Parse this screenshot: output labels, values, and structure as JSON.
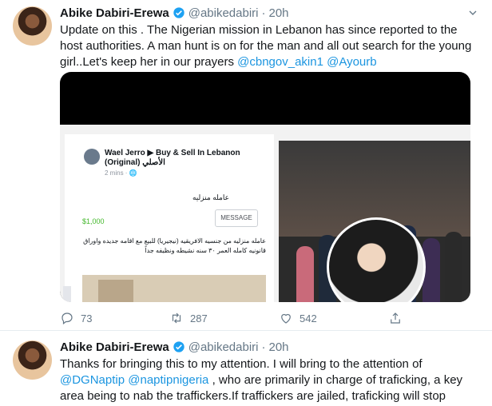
{
  "tweets": [
    {
      "name": "Abike Dabiri-Erewa",
      "handle": "@abikedabiri",
      "separator": "·",
      "time": "20h",
      "text_pre": "Update on this . The Nigerian mission in Lebanon has since reported to the host authorities. A man hunt is on for the man and all out search for the young girl..Let's keep her in our prayers ",
      "mention1": "@cbngov_akin1",
      "mention2": "@Ayourb",
      "media": {
        "fb_title": "Wael Jerro ▶ Buy & Sell In Lebanon (Original) الأصلي",
        "fb_sub": "2 mins · 🌐",
        "fb_arabic": "عامله منزليه",
        "fb_price": "$1,000",
        "fb_message": "MESSAGE",
        "fb_desc": "عامله منزليه من جنسيه الافريقيه (نيجيريا) للبيع مع اقامه جديده واوراق قانونيه كامله العمر ٣٠ سنه نشيطه ونظيفه جداً"
      },
      "counts": {
        "reply": "73",
        "retweet": "287",
        "like": "542"
      }
    },
    {
      "name": "Abike Dabiri-Erewa",
      "handle": "@abikedabiri",
      "separator": "·",
      "time": "20h",
      "text_a": "Thanks for bringing this to my attention. I will bring to the attention of ",
      "mention1": "@DGNaptip",
      "mention2": "@naptipnigeria",
      "text_b": " , who are primarily in charge of traficking, a key area being to nab the traffickers.If traffickers are jailed, traficking will stop"
    }
  ],
  "colors": {
    "link": "#1b95e0",
    "verified": "#1da1f2",
    "secondary": "#657786"
  }
}
